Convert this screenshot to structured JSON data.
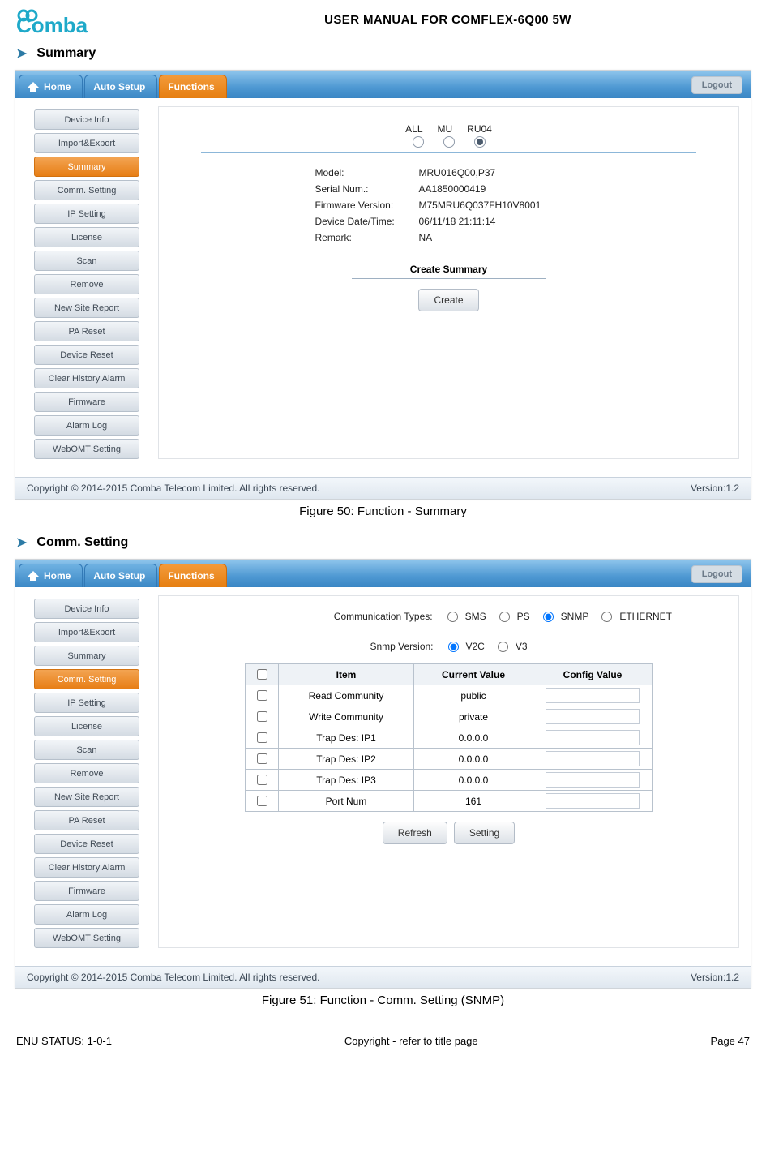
{
  "doc": {
    "title": "USER MANUAL FOR COMFLEX-6Q00 5W",
    "footer_left": "ENU STATUS: 1-0-1",
    "footer_center": "Copyright - refer to title page",
    "footer_right": "Page 47",
    "logo_text": "Comba"
  },
  "section1": {
    "heading": "Summary",
    "caption": "Figure 50: Function - Summary"
  },
  "section2": {
    "heading": "Comm. Setting",
    "caption": "Figure 51: Function - Comm. Setting (SNMP)"
  },
  "nav": {
    "home": "Home",
    "autosetup": "Auto Setup",
    "functions": "Functions",
    "logout": "Logout"
  },
  "sidebar": {
    "items": [
      {
        "label": "Device Info"
      },
      {
        "label": "Import&Export"
      },
      {
        "label": "Summary"
      },
      {
        "label": "Comm. Setting"
      },
      {
        "label": "IP Setting"
      },
      {
        "label": "License"
      },
      {
        "label": "Scan"
      },
      {
        "label": "Remove"
      },
      {
        "label": "New Site Report"
      },
      {
        "label": "PA Reset"
      },
      {
        "label": "Device Reset"
      },
      {
        "label": "Clear History Alarm"
      },
      {
        "label": "Firmware"
      },
      {
        "label": "Alarm Log"
      },
      {
        "label": "WebOMT Setting"
      }
    ]
  },
  "summary": {
    "selector": {
      "opt1": "ALL",
      "opt2": "MU",
      "opt3": "RU04"
    },
    "info": [
      {
        "k": "Model:",
        "v": "MRU016Q00,P37"
      },
      {
        "k": "Serial Num.:",
        "v": "AA1850000419"
      },
      {
        "k": "Firmware Version:",
        "v": "M75MRU6Q037FH10V8001"
      },
      {
        "k": "Device Date/Time:",
        "v": "06/11/18 21:11:14"
      },
      {
        "k": "Remark:",
        "v": "NA"
      }
    ],
    "create_title": "Create Summary",
    "create_btn": "Create"
  },
  "comm": {
    "types_label": "Communication Types:",
    "types": [
      "SMS",
      "PS",
      "SNMP",
      "ETHERNET"
    ],
    "snmp_label": "Snmp Version:",
    "snmp_opts": [
      "V2C",
      "V3"
    ],
    "th": {
      "item": "Item",
      "cur": "Current Value",
      "cfg": "Config Value"
    },
    "rows": [
      {
        "item": "Read Community",
        "cur": "public"
      },
      {
        "item": "Write Community",
        "cur": "private"
      },
      {
        "item": "Trap Des: IP1",
        "cur": "0.0.0.0"
      },
      {
        "item": "Trap Des: IP2",
        "cur": "0.0.0.0"
      },
      {
        "item": "Trap Des: IP3",
        "cur": "0.0.0.0"
      },
      {
        "item": "Port Num",
        "cur": "161"
      }
    ],
    "refresh": "Refresh",
    "setting": "Setting"
  },
  "appfooter": {
    "copyright": "Copyright © 2014-2015 Comba Telecom Limited. All rights reserved.",
    "version": "Version:1.2"
  }
}
